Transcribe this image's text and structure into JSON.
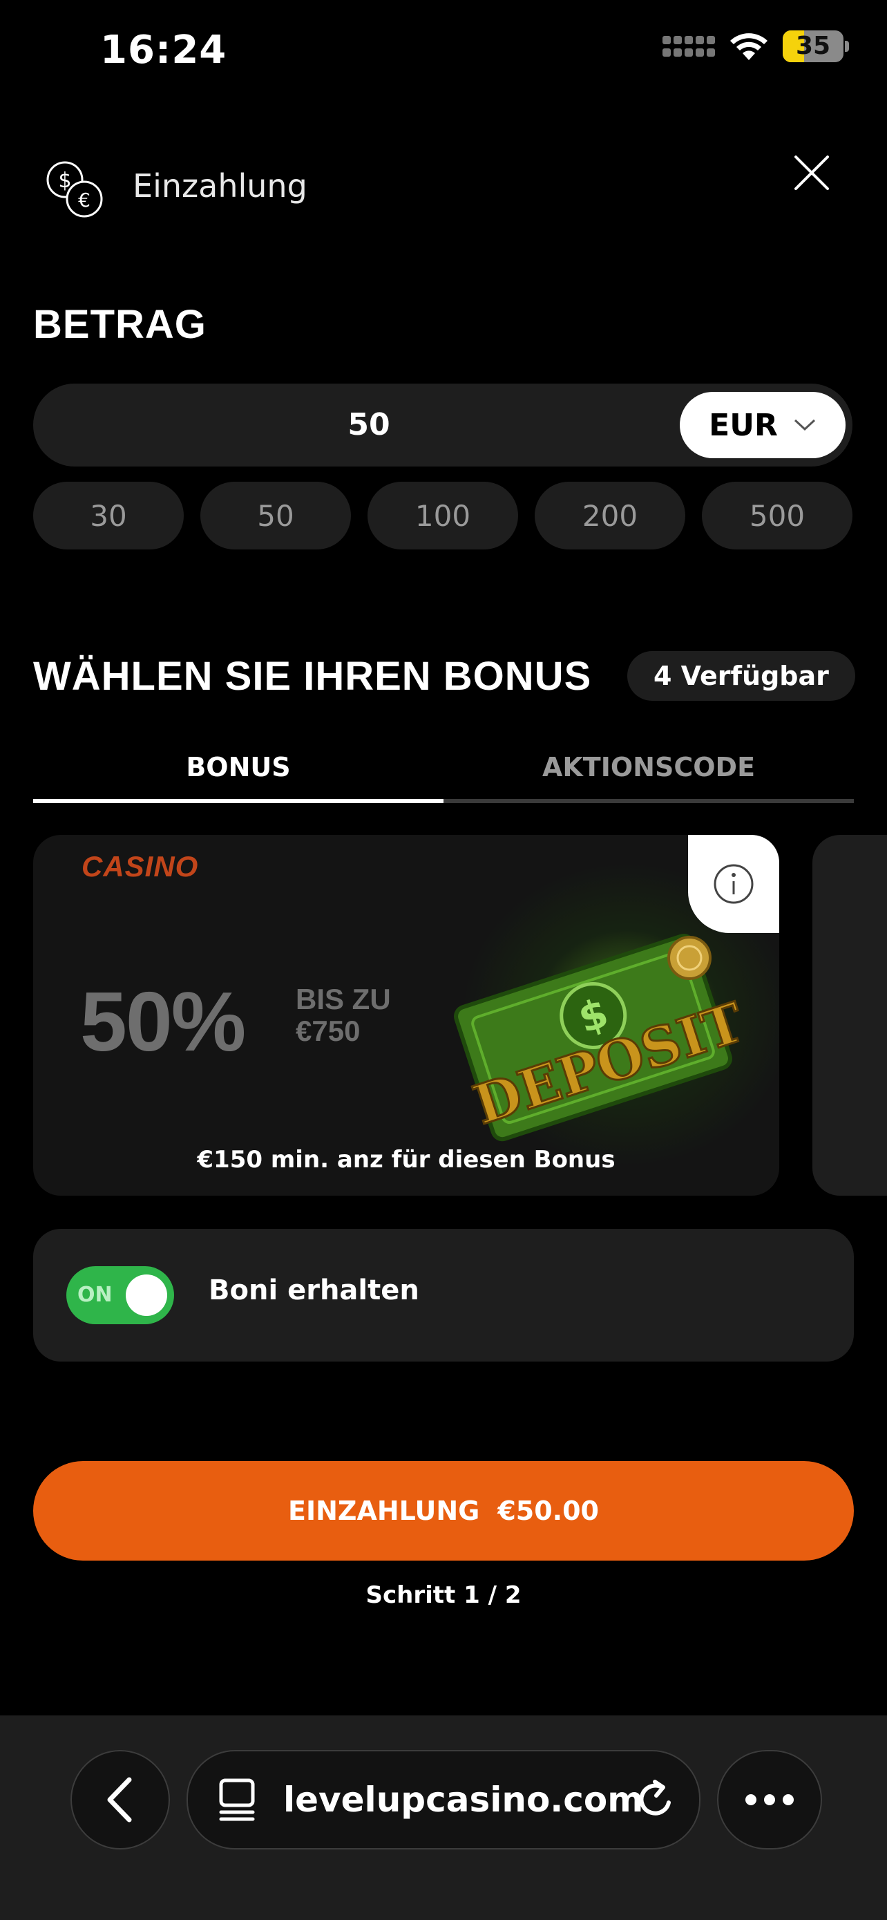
{
  "status_bar": {
    "time": "16:24",
    "battery": "35",
    "battery_level": 0.35
  },
  "header": {
    "title": "Einzahlung",
    "icon": "coins-icon",
    "close_icon": "close-icon"
  },
  "amount": {
    "section_title": "BETRAG",
    "value": "50",
    "currency": "EUR",
    "presets": [
      "30",
      "50",
      "100",
      "200",
      "500"
    ]
  },
  "bonus": {
    "section_title": "WÄHLEN SIE IHREN BONUS",
    "badge": "4 Verfügbar",
    "tabs": [
      {
        "label": "BONUS",
        "active": true
      },
      {
        "label": "AKTIONSCODE",
        "active": false
      }
    ],
    "card": {
      "logo": "CASINO",
      "percent": "50%",
      "up_to_line1": "BIS ZU",
      "up_to_line2": "€750",
      "art_text": "DEPOSIT",
      "min_deposit": "€150 min. anz für diesen Bonus"
    },
    "receive": {
      "toggle_label": "ON",
      "label": "Boni erhalten",
      "enabled": true
    }
  },
  "cta": {
    "label": "EINZAHLUNG",
    "amount": "€50.00",
    "step": "Schritt 1 / 2"
  },
  "browser": {
    "url": "levelupcasino.com"
  },
  "colors": {
    "accent": "#e85e10",
    "toggle_on": "#2fb54a",
    "surface": "#1e1e1e",
    "battery": "#f5d20c"
  }
}
